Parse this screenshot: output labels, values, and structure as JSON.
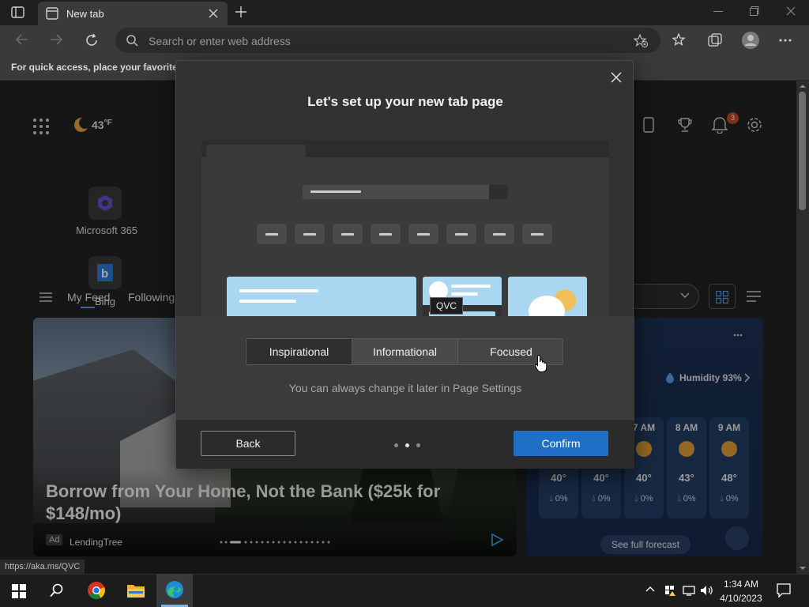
{
  "browser": {
    "tab_title": "New tab",
    "address_placeholder": "Search or enter web address",
    "favorites_hint": "For quick access, place your favorites h"
  },
  "newtab": {
    "weather_temp": "43",
    "weather_unit": "°F",
    "notification_count": "3",
    "quick_links": [
      {
        "label": "Microsoft 365"
      },
      {
        "label": "Bing"
      }
    ],
    "feed_tabs": [
      "My Feed",
      "Following"
    ],
    "hero": {
      "title": "Borrow from Your Home, Not the Bank ($25k for $148/mo)",
      "ad_badge": "Ad",
      "source": "LendingTree"
    },
    "weather_card": {
      "humidity": "Humidity 93%",
      "hours": [
        {
          "time": "7 AM",
          "temp": "40°",
          "precip": "0%"
        },
        {
          "time": "8 AM",
          "temp": "43°",
          "precip": "0%"
        },
        {
          "time": "9 AM",
          "temp": "48°",
          "precip": "0%"
        }
      ],
      "hidden_hours": [
        {
          "temp": "40°",
          "precip": "0%"
        },
        {
          "temp": "40°",
          "precip": "0%"
        }
      ],
      "forecast_link": "See full forecast"
    },
    "status_url": "https://aka.ms/QVC"
  },
  "dialog": {
    "title": "Let's set up your new tab page",
    "modes": [
      "Inspirational",
      "Informational",
      "Focused"
    ],
    "hint": "You can always change it later in Page Settings",
    "back_label": "Back",
    "confirm_label": "Confirm",
    "tooltip": "QVC",
    "page_indicator": {
      "current": 2,
      "total": 3
    }
  },
  "taskbar": {
    "time": "1:34 AM",
    "date": "4/10/2023"
  },
  "colors": {
    "accent": "#1f6fc6",
    "dialog_bg": "#323232",
    "weather_bg": "#1c3154"
  }
}
